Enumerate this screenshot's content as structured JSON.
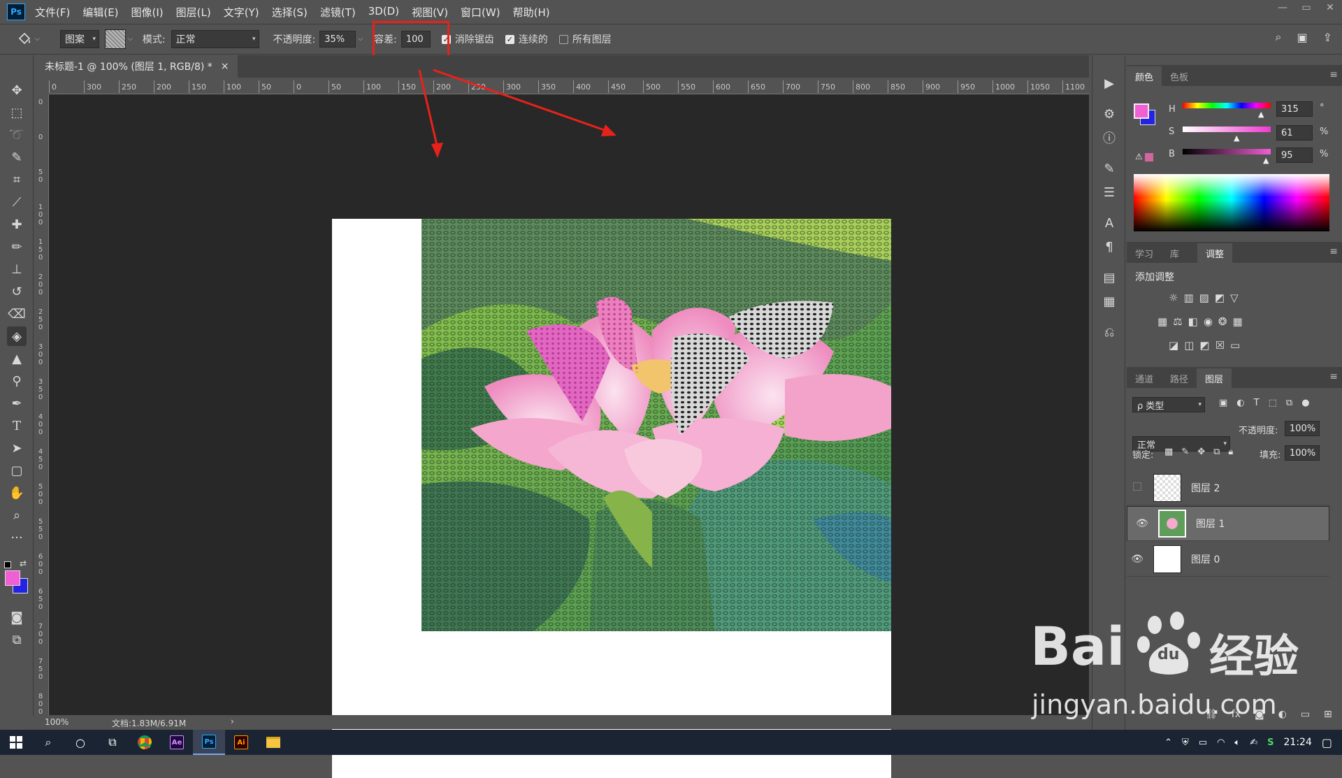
{
  "app": {
    "logo": "Ps",
    "menu": [
      "文件(F)",
      "编辑(E)",
      "图像(I)",
      "图层(L)",
      "文字(Y)",
      "选择(S)",
      "滤镜(T)",
      "3D(D)",
      "视图(V)",
      "窗口(W)",
      "帮助(H)"
    ]
  },
  "options": {
    "source": "图案",
    "mode_label": "模式:",
    "mode_value": "正常",
    "opacity_label": "不透明度:",
    "opacity_value": "35%",
    "tolerance_label": "容差:",
    "tolerance_value": "100",
    "antialias_label": "消除锯齿",
    "contiguous_label": "连续的",
    "all_layers_label": "所有图层"
  },
  "document": {
    "tab_title": "未标题-1 @ 100% (图层 1, RGB/8) *",
    "close": "×"
  },
  "rulers": {
    "horizontal": [
      "0",
      "300",
      "250",
      "200",
      "150",
      "100",
      "50",
      "0",
      "50",
      "100",
      "150",
      "200",
      "250",
      "300",
      "350",
      "400",
      "450",
      "500",
      "550",
      "600",
      "650",
      "700",
      "750",
      "800",
      "850",
      "900",
      "950",
      "1000",
      "1050",
      "1100"
    ],
    "vertical": [
      "0",
      "0",
      "50",
      "100",
      "150",
      "200",
      "250",
      "300",
      "350",
      "400",
      "450",
      "500",
      "550",
      "600",
      "650",
      "700",
      "750",
      "800"
    ]
  },
  "status": {
    "zoom": "100%",
    "doc_size": "文档:1.83M/6.91M",
    "arrow": "›"
  },
  "color_panel": {
    "tabs": [
      "颜色",
      "色板"
    ],
    "h_label": "H",
    "h_value": "315",
    "h_unit": "°",
    "s_label": "S",
    "s_value": "61",
    "s_unit": "%",
    "b_label": "B",
    "b_value": "95",
    "b_unit": "%",
    "foreground": "#f15fd4",
    "background": "#2323e6"
  },
  "adjust_panel": {
    "tabs": [
      "学习",
      "库",
      "调整"
    ],
    "heading": "添加调整"
  },
  "layers_panel": {
    "tabs": [
      "通道",
      "路径",
      "图层"
    ],
    "filter": "ρ 类型",
    "blend_mode": "正常",
    "opacity_label": "不透明度:",
    "opacity_value": "100%",
    "lock_label": "锁定:",
    "fill_label": "填充:",
    "fill_value": "100%",
    "layers": [
      {
        "name": "图层 2",
        "visible": false
      },
      {
        "name": "图层 1",
        "visible": true,
        "selected": true
      },
      {
        "name": "图层 0",
        "visible": true
      }
    ]
  },
  "taskbar": {
    "time": "21:24",
    "apps": [
      "windows-start-icon",
      "search-icon",
      "cortana-icon",
      "task-view-icon",
      "chrome-icon",
      "after-effects-icon",
      "photoshop-icon",
      "illustrator-icon",
      "file-explorer-icon"
    ],
    "ae": "Ae",
    "ps": "Ps",
    "ai": "Ai"
  },
  "watermark": {
    "brand": "Bai",
    "brand_cn": "经验",
    "url": "jingyan.baidu.com",
    "du": "du"
  },
  "colors": {
    "annotation_red": "#e8221b",
    "ui_gray": "#535353",
    "pasteboard": "#282828"
  }
}
